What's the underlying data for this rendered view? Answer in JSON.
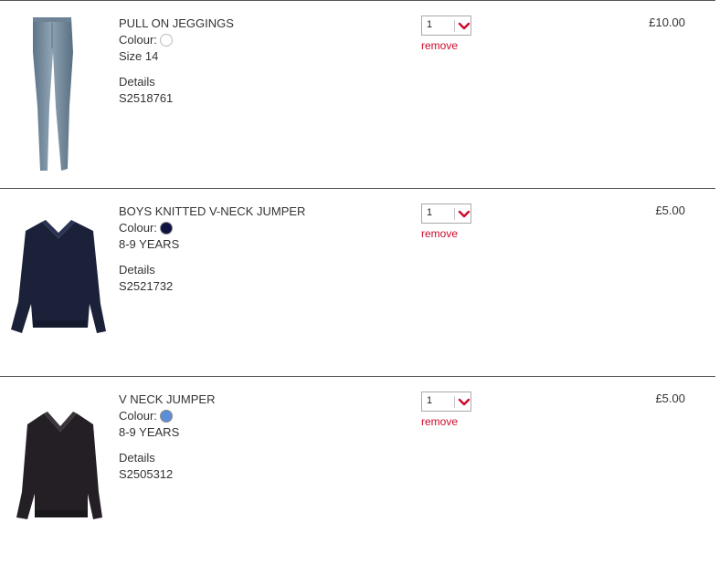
{
  "basket": {
    "items": [
      {
        "name": "PULL ON JEGGINGS",
        "colour_label": "Colour:",
        "colour_hex": "#ffffff",
        "size": "Size 14",
        "details_label": "Details",
        "code": "S2518761",
        "quantity": "1",
        "remove_label": "remove",
        "price": "£10.00",
        "image_icon": "jeggings-image"
      },
      {
        "name": "BOYS KNITTED V-NECK JUMPER",
        "colour_label": "Colour:",
        "colour_hex": "#0d1240",
        "size": "8-9 YEARS",
        "details_label": "Details",
        "code": "S2521732",
        "quantity": "1",
        "remove_label": "remove",
        "price": "£5.00",
        "image_icon": "navy-jumper-image"
      },
      {
        "name": "V NECK JUMPER",
        "colour_label": "Colour:",
        "colour_hex": "#5b8ed6",
        "size": "8-9 YEARS",
        "details_label": "Details",
        "code": "S2505312",
        "quantity": "1",
        "remove_label": "remove",
        "price": "£5.00",
        "image_icon": "dark-jumper-image"
      }
    ]
  },
  "colors": {
    "accent": "#cc0a2c",
    "divider": "#555555",
    "text": "#333333"
  }
}
